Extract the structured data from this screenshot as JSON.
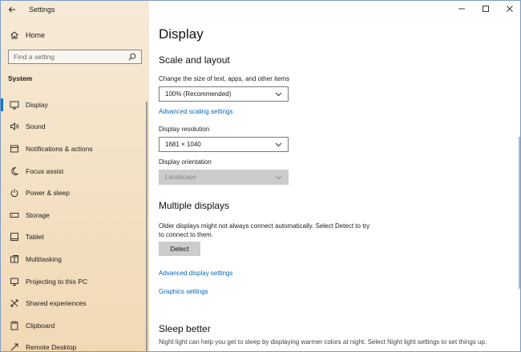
{
  "window": {
    "app_title": "Settings"
  },
  "sidebar": {
    "home_label": "Home",
    "search_placeholder": "Find a setting",
    "section_label": "System",
    "items": [
      {
        "label": "Display",
        "icon": "monitor-icon",
        "selected": true
      },
      {
        "label": "Sound",
        "icon": "speaker-icon"
      },
      {
        "label": "Notifications & actions",
        "icon": "notification-icon"
      },
      {
        "label": "Focus assist",
        "icon": "moon-icon"
      },
      {
        "label": "Power & sleep",
        "icon": "power-icon"
      },
      {
        "label": "Storage",
        "icon": "storage-icon"
      },
      {
        "label": "Tablet",
        "icon": "tablet-icon"
      },
      {
        "label": "Multitasking",
        "icon": "multitasking-icon"
      },
      {
        "label": "Projecting to this PC",
        "icon": "projecting-icon"
      },
      {
        "label": "Shared experiences",
        "icon": "shared-icon"
      },
      {
        "label": "Clipboard",
        "icon": "clipboard-icon"
      },
      {
        "label": "Remote Desktop",
        "icon": "remote-icon"
      }
    ]
  },
  "main": {
    "title": "Display",
    "scale": {
      "heading": "Scale and layout",
      "size_label": "Change the size of text, apps, and other items",
      "size_value": "100% (Recommended)",
      "advanced_link": "Advanced scaling settings",
      "resolution_label": "Display resolution",
      "resolution_value": "1681 × 1040",
      "orientation_label": "Display orientation",
      "orientation_value": "Landscape"
    },
    "multiple": {
      "heading": "Multiple displays",
      "description": "Older displays might not always connect automatically. Select Detect to try to connect to them.",
      "detect_button": "Detect",
      "advanced_display_link": "Advanced display settings",
      "graphics_link": "Graphics settings"
    },
    "sleep": {
      "heading": "Sleep better",
      "description": "Night light can help you get to sleep by displaying warmer colors at night. Select Night light settings to set things up."
    }
  },
  "colors": {
    "accent": "#0078d4",
    "link": "#0067b8"
  }
}
